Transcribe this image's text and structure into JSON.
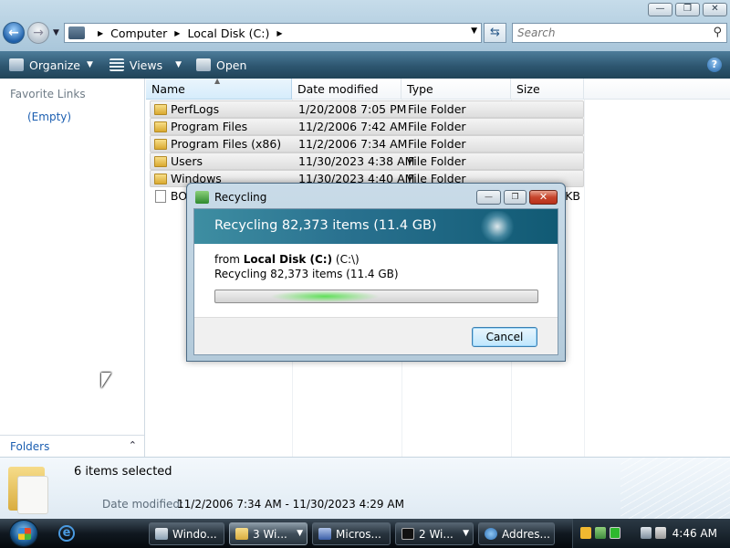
{
  "address": {
    "crumbs": [
      "Computer",
      "Local Disk (C:)"
    ],
    "search_placeholder": "Search"
  },
  "toolbar": {
    "organize": "Organize",
    "views": "Views",
    "open": "Open",
    "help": "?"
  },
  "nav": {
    "favorite_links": "Favorite Links",
    "empty": "(Empty)",
    "folders": "Folders"
  },
  "columns": [
    "Name",
    "Date modified",
    "Type",
    "Size"
  ],
  "files": [
    {
      "name": "PerfLogs",
      "date": "1/20/2008 7:05 PM",
      "type": "File Folder",
      "size": "",
      "icon": "folder-icon"
    },
    {
      "name": "Program Files",
      "date": "11/2/2006 7:42 AM",
      "type": "File Folder",
      "size": "",
      "icon": "folder-icon"
    },
    {
      "name": "Program Files (x86)",
      "date": "11/2/2006 7:34 AM",
      "type": "File Folder",
      "size": "",
      "icon": "folder-icon"
    },
    {
      "name": "Users",
      "date": "11/30/2023 4:38 AM",
      "type": "File Folder",
      "size": "",
      "icon": "folder-icon"
    },
    {
      "name": "Windows",
      "date": "11/30/2023 4:40 AM",
      "type": "File Folder",
      "size": "",
      "icon": "folder-icon"
    },
    {
      "name": "BO",
      "date": "",
      "type": "",
      "size": "KB",
      "icon": "file-icon"
    }
  ],
  "details": {
    "selection": "6 items selected",
    "date_label": "Date modified:",
    "date_value": "11/2/2006 7:34 AM - 11/30/2023 4:29 AM"
  },
  "dialog": {
    "title": "Recycling",
    "banner": "Recycling 82,373 items (11.4 GB)",
    "from_prefix": "from ",
    "from_drive": "Local Disk (C:)",
    "from_path": " (C:\\)",
    "status": "Recycling 82,373 items (11.4 GB)",
    "cancel": "Cancel",
    "progress_state": "indeterminate"
  },
  "taskbar": {
    "buttons": [
      "Windo...",
      "3 Wi...",
      "Micros...",
      "2 Wi...",
      "Addres..."
    ],
    "clock": "4:46 AM"
  },
  "window_controls": {
    "minimize": "—",
    "maximize": "❐",
    "close": "✕"
  }
}
